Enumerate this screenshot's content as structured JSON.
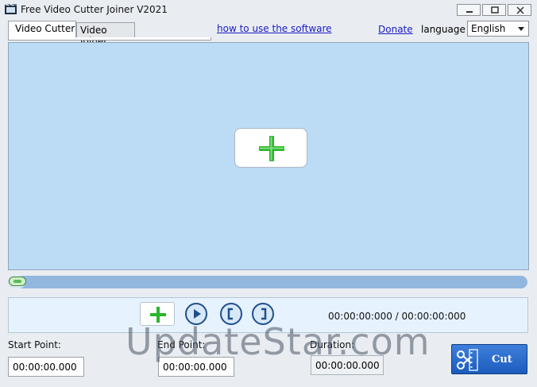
{
  "window": {
    "title": "Free Video Cutter Joiner V2021"
  },
  "tabs": [
    {
      "label": "Video Cutter"
    },
    {
      "label": "Video Joiner"
    }
  ],
  "header": {
    "howto_link": "how to use the software",
    "donate_link": "Donate",
    "language_label": "language",
    "language_value": "English"
  },
  "player": {
    "progress": 0.0,
    "time_current": "00:00:00:000",
    "time_separator": "/",
    "time_total": "00:00:00:000"
  },
  "fields": {
    "start_label": "Start Point:",
    "start_value": "00:00:00.000",
    "end_label": "End Point:",
    "end_value": "00:00:00.000",
    "duration_label": "Duration:",
    "duration_value": "00:00:00.000"
  },
  "cut_button": {
    "label": "Cut"
  },
  "watermark": {
    "text": "UpdateStar.com"
  },
  "colors": {
    "video_area": "#bcdcf6",
    "add_icon": "#2bb52b",
    "cut_button": "#2a68cc",
    "link": "#1a1ac8"
  }
}
